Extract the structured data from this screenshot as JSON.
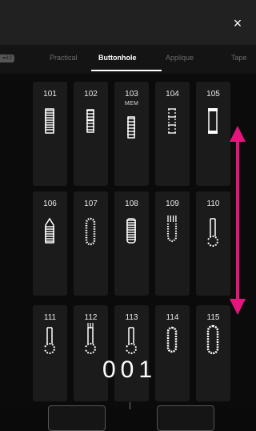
{
  "header": {
    "close_icon": "×"
  },
  "tabs": {
    "prev_chip": "⬅12",
    "items": [
      {
        "label": "Practical"
      },
      {
        "label": "Buttonhole"
      },
      {
        "label": "Applique"
      },
      {
        "label": "Tape"
      }
    ],
    "active": "Buttonhole"
  },
  "stitches": [
    {
      "number": "101",
      "icon": "buttonhole-rect-bartack-icon"
    },
    {
      "number": "102",
      "icon": "buttonhole-auto-icon"
    },
    {
      "number": "103",
      "icon": "buttonhole-memory-icon",
      "badge": "MEM"
    },
    {
      "number": "104",
      "icon": "buttonhole-open-end-icon"
    },
    {
      "number": "105",
      "icon": "buttonhole-round-end-icon"
    },
    {
      "number": "106",
      "icon": "buttonhole-pointed-icon"
    },
    {
      "number": "107",
      "icon": "buttonhole-scalloped-icon"
    },
    {
      "number": "108",
      "icon": "buttonhole-square-end-icon"
    },
    {
      "number": "109",
      "icon": "buttonhole-fringed-icon"
    },
    {
      "number": "110",
      "icon": "buttonhole-keyhole-icon"
    },
    {
      "number": "111",
      "icon": "buttonhole-keyhole-tapered-icon"
    },
    {
      "number": "112",
      "icon": "buttonhole-keyhole-open-icon"
    },
    {
      "number": "113",
      "icon": "buttonhole-keyhole-round-icon"
    },
    {
      "number": "114",
      "icon": "buttonhole-eyelet-oval-icon"
    },
    {
      "number": "115",
      "icon": "buttonhole-eyelet-long-icon"
    }
  ],
  "counter": "001",
  "scroll_indicator_color": "#e5157d"
}
